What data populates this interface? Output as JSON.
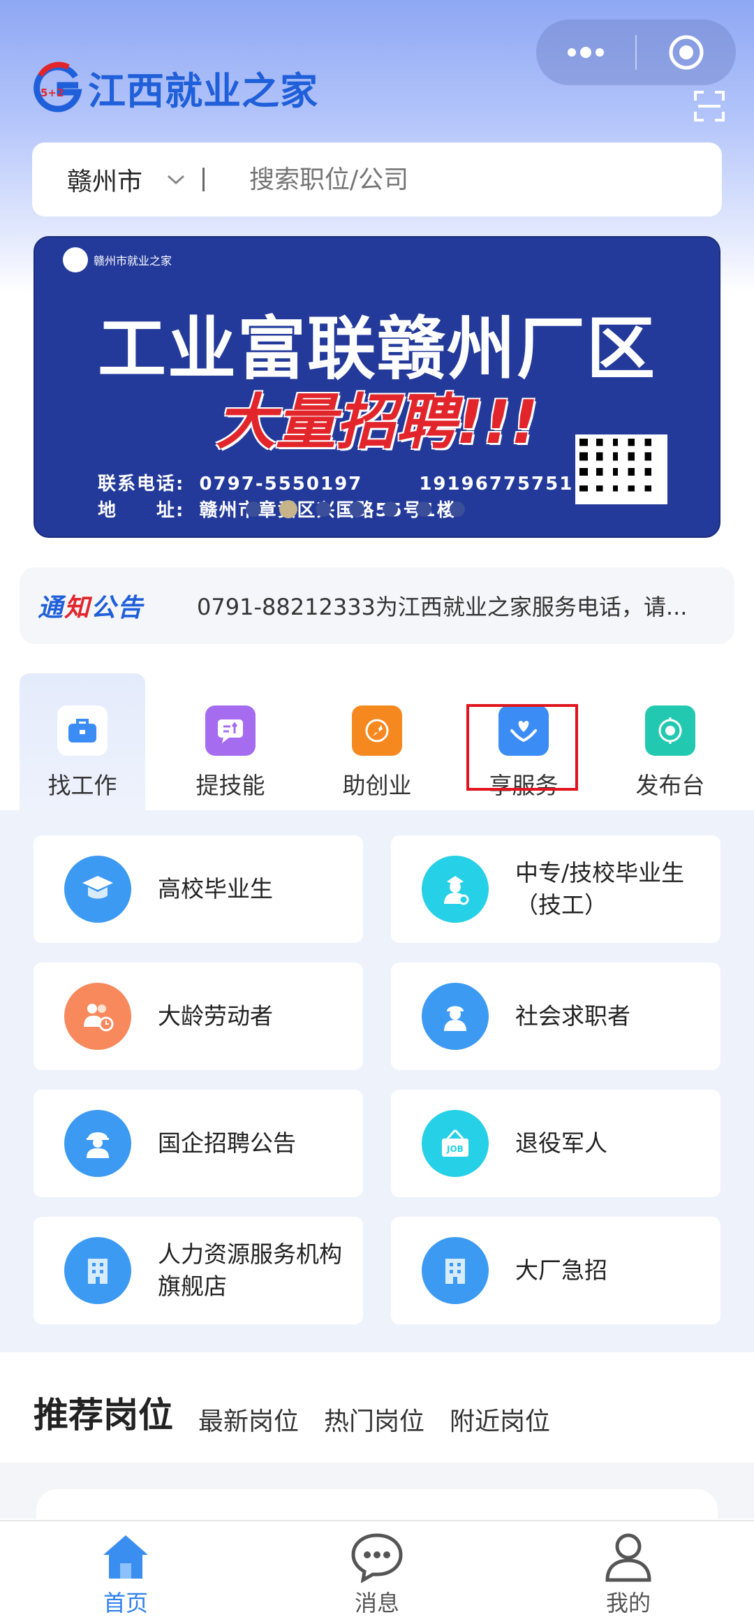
{
  "header": {
    "app_title": "江西就业之家",
    "logo_badge": "5+2"
  },
  "search": {
    "city": "赣州市",
    "placeholder": "搜索职位/公司"
  },
  "banner": {
    "org": "赣州市就业之家",
    "title": "工业富联赣州厂区",
    "subtitle": "大量招聘!!!",
    "phone_label": "联系电话:",
    "phone_1": "0797-5550197",
    "phone_2": "19196775751",
    "address_label": "地　　址:",
    "address": "赣州市章贡区兴国路55号1楼",
    "carousel_count": 7,
    "carousel_active": 1
  },
  "notice": {
    "tag_a": "通",
    "tag_b": "知",
    "tag_c": "公告",
    "text": "0791-88212333为江西就业之家服务电话，请..."
  },
  "categories": [
    {
      "label": "找工作",
      "icon": "briefcase-icon",
      "color": "#3b8cf5",
      "selected": true
    },
    {
      "label": "提技能",
      "icon": "skill-chat-icon",
      "color": "#a66cf0",
      "selected": false
    },
    {
      "label": "助创业",
      "icon": "rocket-icon",
      "color": "#f5891f",
      "selected": false
    },
    {
      "label": "享服务",
      "icon": "heart-hands-icon",
      "color": "#3b8cf5",
      "selected": false
    },
    {
      "label": "发布台",
      "icon": "target-icon",
      "color": "#22c9b0",
      "selected": false
    }
  ],
  "cards": [
    {
      "label": "高校毕业生",
      "icon": "graduate-icon",
      "color": "#3d9af2"
    },
    {
      "label": "中专/技校毕业生（技工）",
      "icon": "technician-icon",
      "color": "#26d0e6"
    },
    {
      "label": "大龄劳动者",
      "icon": "elderly-clock-icon",
      "color": "#f7895c"
    },
    {
      "label": "社会求职者",
      "icon": "worker-icon",
      "color": "#3d9af2"
    },
    {
      "label": "国企招聘公告",
      "icon": "engineer-icon",
      "color": "#3d9af2"
    },
    {
      "label": "退役军人",
      "icon": "job-sign-icon",
      "color": "#26d0e6"
    },
    {
      "label": "人力资源服务机构旗舰店",
      "icon": "building-icon",
      "color": "#3d9af2"
    },
    {
      "label": "大厂急招",
      "icon": "building-icon",
      "color": "#3d9af2"
    }
  ],
  "recommend": {
    "heading": "推荐岗位",
    "tabs": [
      "最新岗位",
      "热门岗位",
      "附近岗位"
    ]
  },
  "tabbar": [
    {
      "label": "首页",
      "icon": "home-icon",
      "active": true
    },
    {
      "label": "消息",
      "icon": "message-icon",
      "active": false
    },
    {
      "label": "我的",
      "icon": "profile-icon",
      "active": false
    }
  ],
  "colors": {
    "accent": "#2f80ed",
    "brand_blue": "#1f5fd9",
    "highlight_red": "#e0141d"
  }
}
